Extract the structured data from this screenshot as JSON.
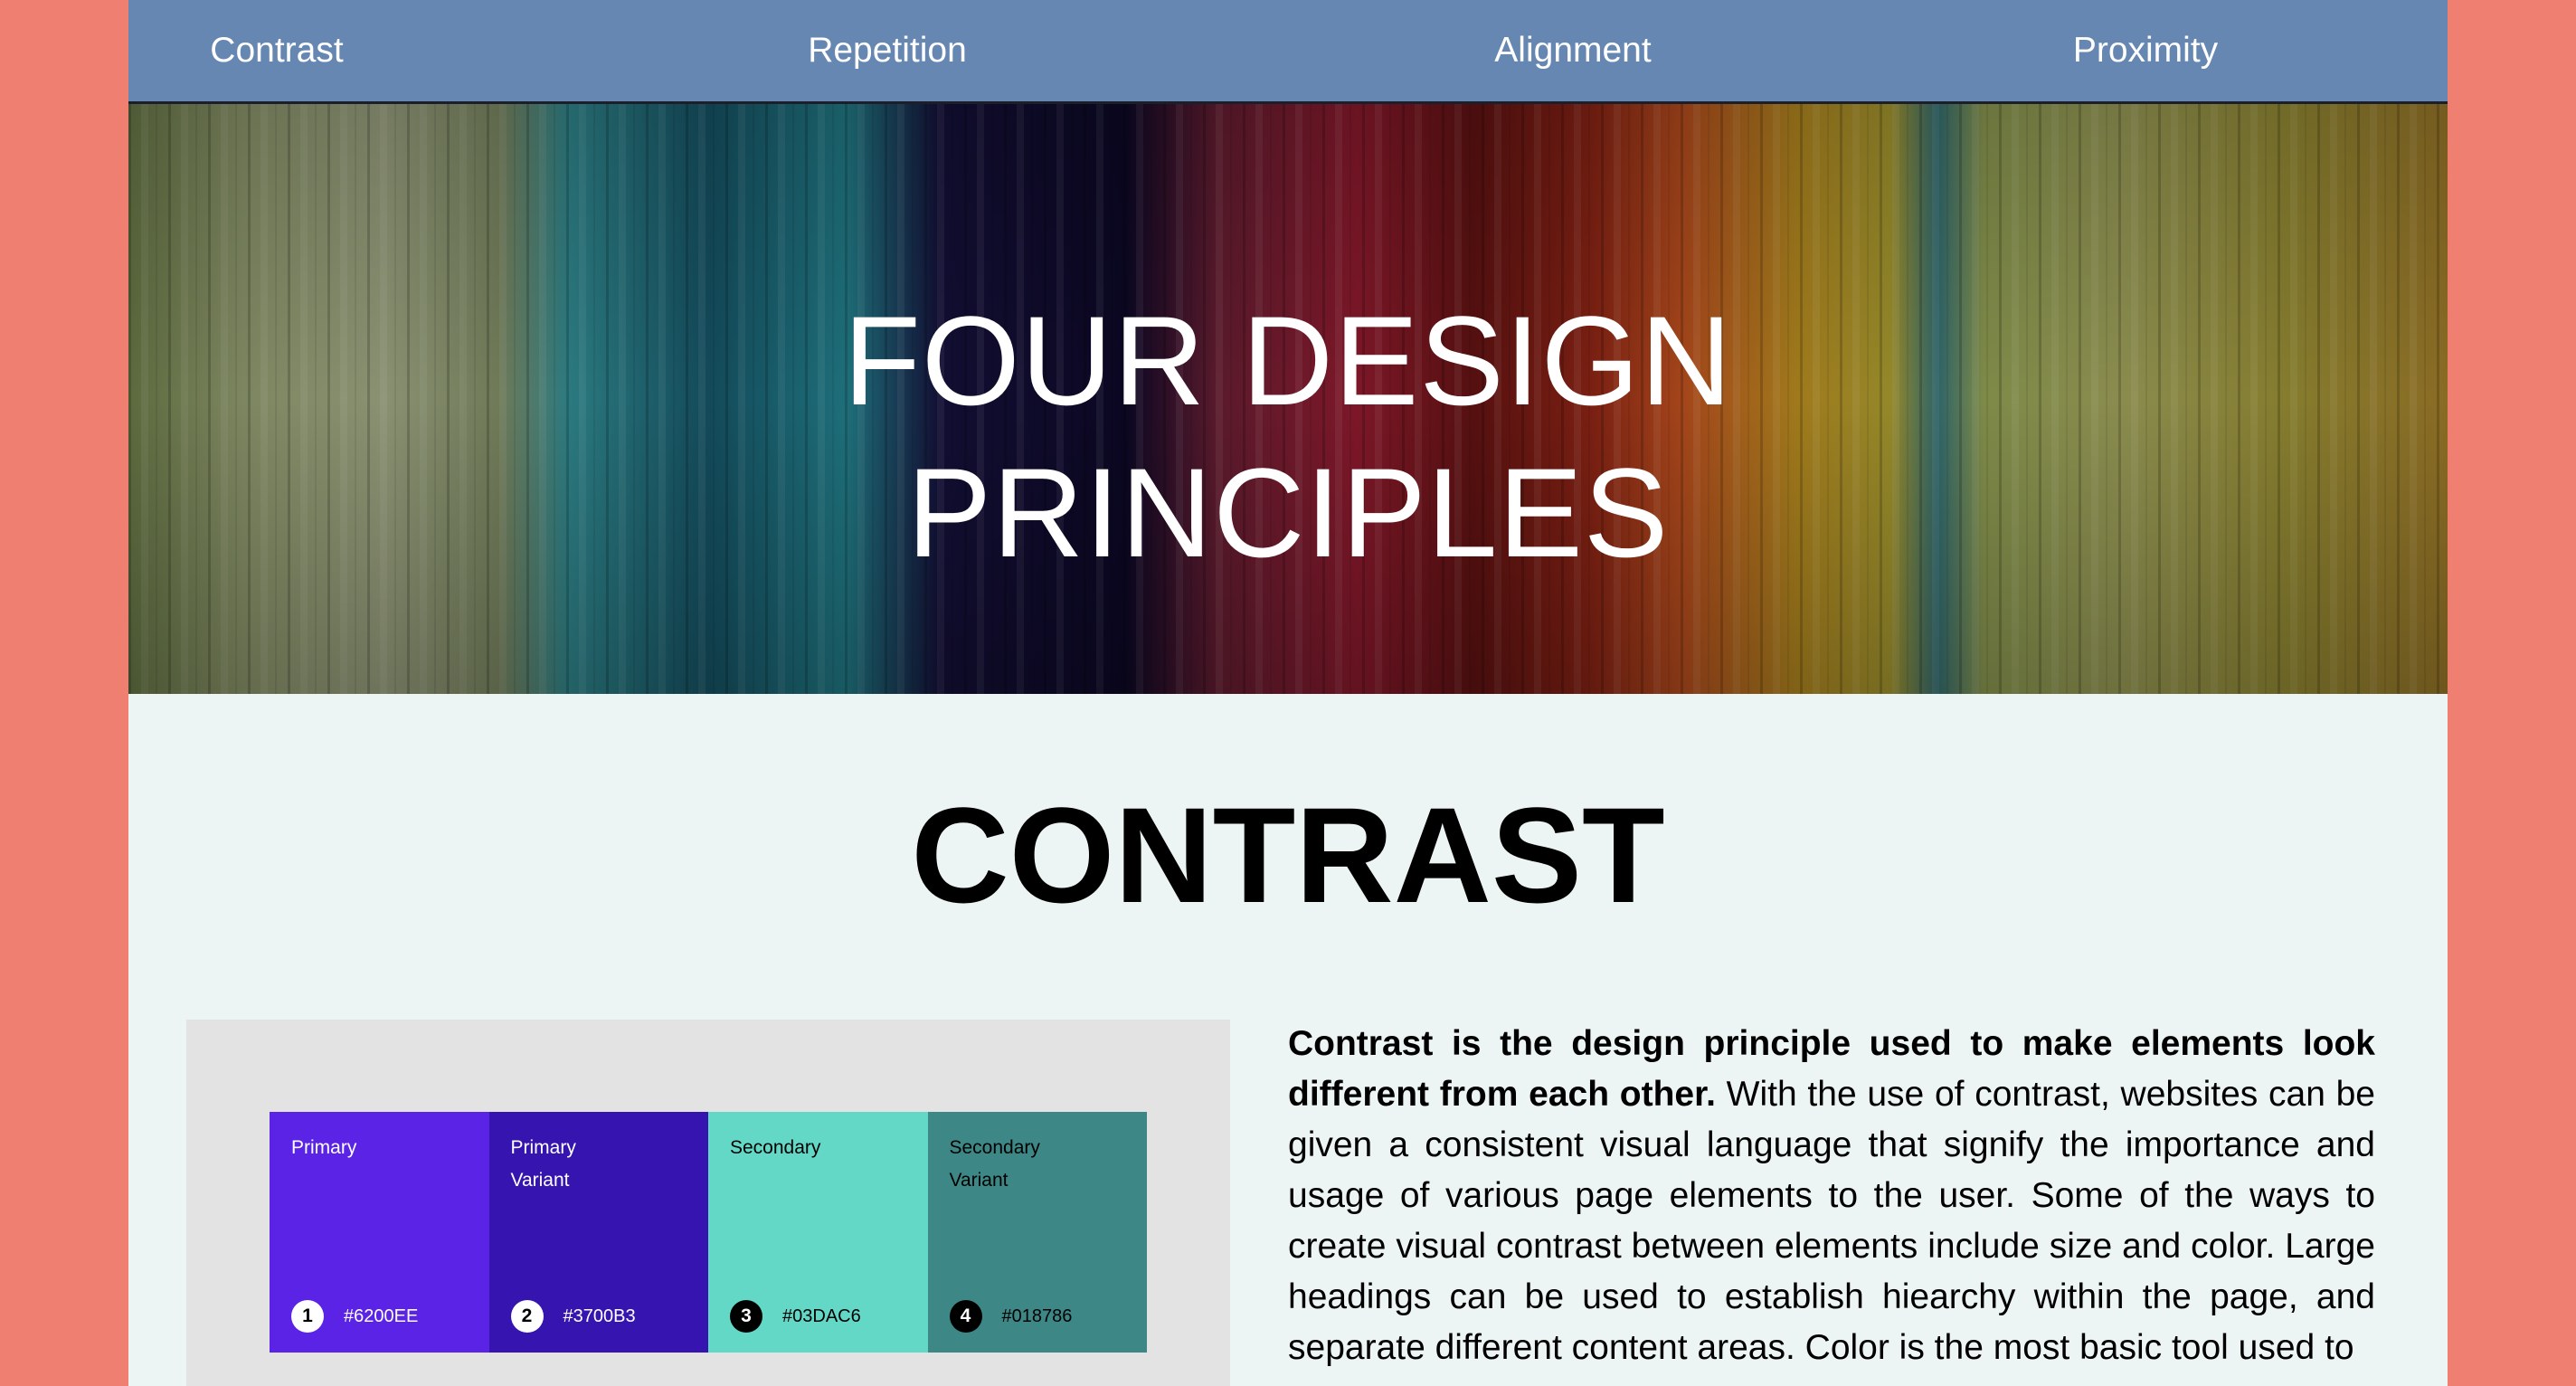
{
  "nav": {
    "items": [
      {
        "label": "Contrast"
      },
      {
        "label": "Repetition"
      },
      {
        "label": "Alignment"
      },
      {
        "label": "Proximity"
      }
    ]
  },
  "hero": {
    "title_line1": "FOUR DESIGN",
    "title_line2": "PRINCIPLES"
  },
  "section": {
    "title": "CONTRAST",
    "intro_bold": "Contrast is the design principle used to make elements look different from each other.",
    "body": " With the use of contrast, websites can be given a consistent visual language that signify the importance and usage of various page elements to the user. Some of the ways to create visual contrast between elements include size and color. Large headings can be used to establish hiearchy within the page, and separate different content areas. Color is the most basic tool used to"
  },
  "palette": {
    "swatches": [
      {
        "name": "Primary",
        "number": "1",
        "hex": "#6200EE",
        "color": "#5b23e6",
        "text_color": "#ffffff"
      },
      {
        "name": "Primary\nVariant",
        "number": "2",
        "hex": "#3700B3",
        "color": "#3514b0",
        "text_color": "#ffffff"
      },
      {
        "name": "Secondary",
        "number": "3",
        "hex": "#03DAC6",
        "color": "#63d8c7",
        "text_color": "#000000"
      },
      {
        "name": "Secondary\nVariant",
        "number": "4",
        "hex": "#018786",
        "color": "#3d8886",
        "text_color": "#000000"
      }
    ]
  }
}
